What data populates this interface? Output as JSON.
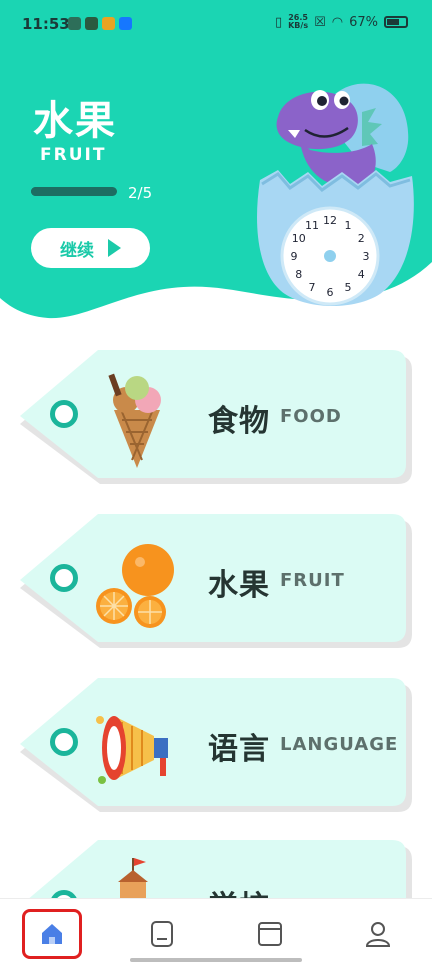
{
  "status_bar": {
    "time": "11:53",
    "net_speed_value": "26.5",
    "net_speed_unit": "KB/s",
    "battery": "67%"
  },
  "header": {
    "title_zh": "水果",
    "title_en": "FRUIT",
    "progress_text": "2/5",
    "progress_fraction": 0.4,
    "continue_label": "继续",
    "clock_numbers": [
      "12",
      "1",
      "2",
      "3",
      "4",
      "5",
      "6",
      "7",
      "8",
      "9",
      "10",
      "11"
    ]
  },
  "cards": [
    {
      "zh": "食物",
      "en": "FOOD",
      "icon": "ice-cream-icon"
    },
    {
      "zh": "水果",
      "en": "FRUIT",
      "icon": "orange-icon"
    },
    {
      "zh": "语言",
      "en": "LANGUAGE",
      "icon": "megaphone-icon"
    },
    {
      "zh": "学校",
      "en": "",
      "icon": "school-icon"
    }
  ],
  "nav": {
    "items": [
      "home-icon",
      "book-icon",
      "card-icon",
      "profile-icon"
    ],
    "active": "home-icon"
  },
  "colors": {
    "accent": "#1bd1b0",
    "card": "#dbfbf4",
    "card_shadow": "#e7e7e7",
    "active_nav": "#4a7fe6",
    "highlight_border": "#e02020"
  }
}
